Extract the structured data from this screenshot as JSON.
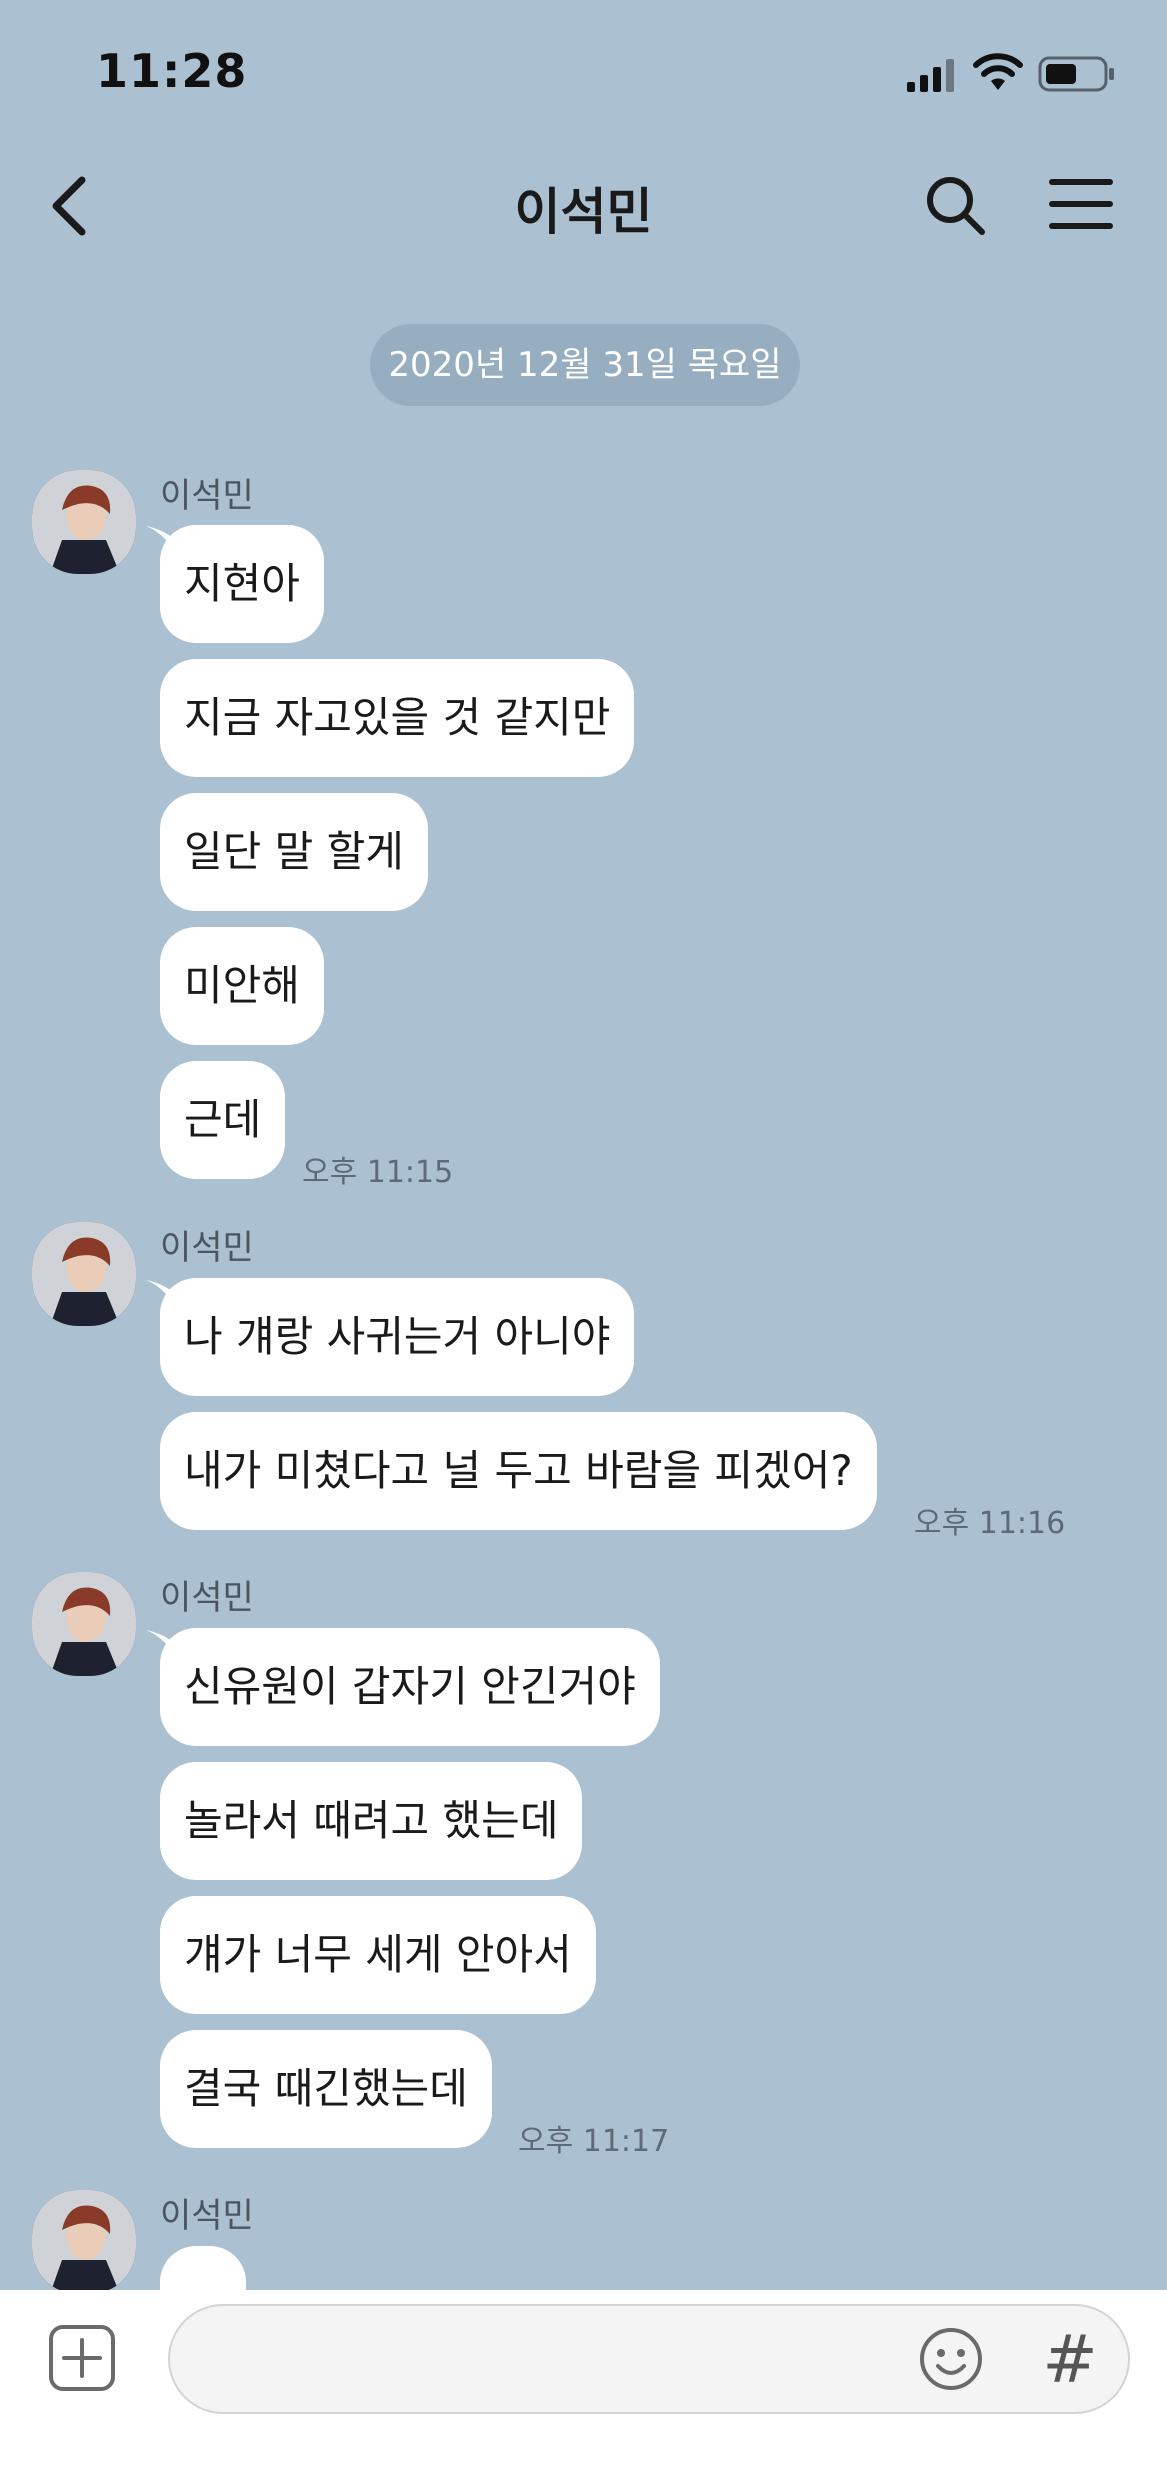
{
  "status_bar": {
    "time": "11:28"
  },
  "header": {
    "title": "이석민"
  },
  "date_divider": "2020년 12월 31일 목요일",
  "groups": [
    {
      "sender": "이석민",
      "messages": [
        "지현아",
        "지금 자고있을 것 같지만",
        "일단 말 할게",
        "미안해",
        "근데"
      ],
      "time": "오후 11:15"
    },
    {
      "sender": "이석민",
      "messages": [
        "나 걔랑 사귀는거 아니야",
        "내가 미쳤다고 널 두고 바람을 피겠어?"
      ],
      "time": "오후 11:16"
    },
    {
      "sender": "이석민",
      "messages": [
        "신유원이 갑자기 안긴거야",
        "놀라서 때려고 했는데",
        "걔가 너무 세게 안아서",
        "결국 때긴했는데"
      ],
      "time": "오후 11:17"
    },
    {
      "sender": "이석민",
      "messages": []
    }
  ],
  "input": {
    "value": "",
    "placeholder": ""
  },
  "icons": {
    "back": "chevron-left-icon",
    "search": "search-icon",
    "menu": "menu-icon",
    "attach": "plus-square-icon",
    "emoji": "smiley-icon",
    "hash": "#"
  },
  "colors": {
    "background": "#abc1d2",
    "bubble": "#ffffff",
    "date_pill": "#97aec0"
  }
}
